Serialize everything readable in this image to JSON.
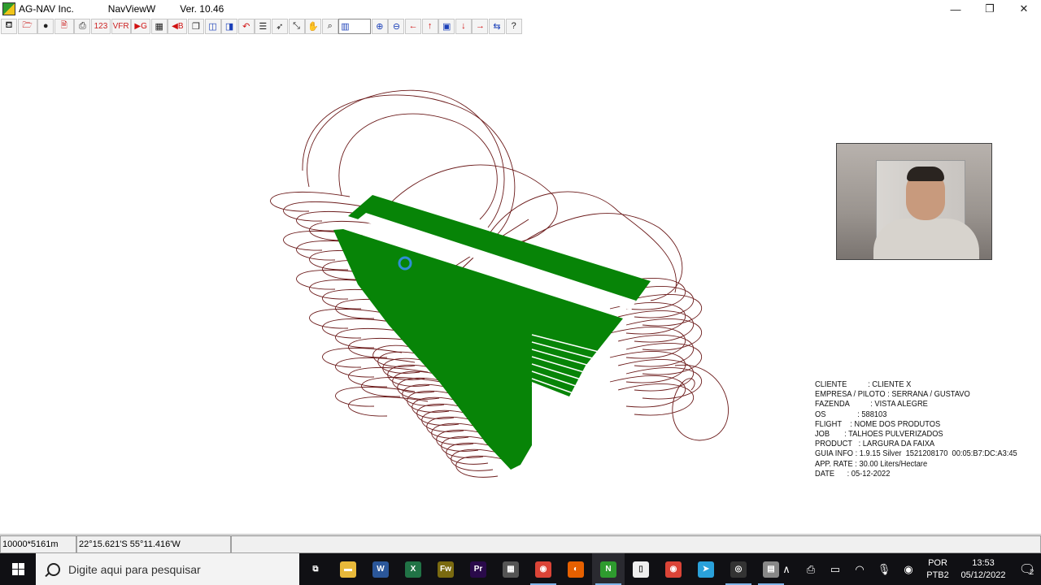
{
  "window": {
    "company": "AG-NAV Inc.",
    "app_name": "NavViewW",
    "version": "Ver. 10.46",
    "minimize": "—",
    "restore": "❐",
    "close": "✕"
  },
  "toolbar": {
    "items": [
      {
        "name": "exit-icon",
        "glyph": "⛾"
      },
      {
        "name": "open-folder-icon",
        "glyph": "🗁"
      },
      {
        "name": "globe-icon",
        "glyph": "●"
      },
      {
        "name": "document-icon",
        "glyph": "🗎"
      },
      {
        "name": "print-icon",
        "glyph": "⎙"
      },
      {
        "name": "numbers-button",
        "glyph": "123"
      },
      {
        "name": "vfr-button",
        "glyph": "VFR"
      },
      {
        "name": "arrow-right-g-icon",
        "glyph": "▶G"
      },
      {
        "name": "grid-icon",
        "glyph": "▦"
      },
      {
        "name": "arrow-left-b-icon",
        "glyph": "◀B"
      },
      {
        "name": "pages-icon",
        "glyph": "❐"
      },
      {
        "name": "frame-left-icon",
        "glyph": "◫"
      },
      {
        "name": "frame-right-icon",
        "glyph": "◨"
      },
      {
        "name": "undo-icon",
        "glyph": "↶"
      },
      {
        "name": "list-icon",
        "glyph": "☰"
      },
      {
        "name": "pointer-icon",
        "glyph": "➶"
      },
      {
        "name": "resize-icon",
        "glyph": "⤡"
      },
      {
        "name": "hand-icon",
        "glyph": "✋"
      },
      {
        "name": "zoom-window-icon",
        "glyph": "⌕"
      }
    ],
    "field_value": "▥",
    "nav_items": [
      {
        "name": "zoom-in-icon",
        "glyph": "⊕"
      },
      {
        "name": "zoom-out-icon",
        "glyph": "⊖"
      },
      {
        "name": "pan-left-icon",
        "glyph": "←"
      },
      {
        "name": "pan-up-icon",
        "glyph": "↑"
      },
      {
        "name": "fit-view-icon",
        "glyph": "▣"
      },
      {
        "name": "pan-down-icon",
        "glyph": "↓"
      },
      {
        "name": "pan-right-icon",
        "glyph": "→"
      },
      {
        "name": "swap-icon",
        "glyph": "⇆"
      },
      {
        "name": "help-icon",
        "glyph": "?"
      }
    ]
  },
  "colors": {
    "coverage": "#078407",
    "flight_path": "#6b1a1a",
    "cursor": "#2f8fd6",
    "taskbar": "#101014"
  },
  "info": {
    "rows": [
      {
        "key": "CLIENTE          ",
        "value": ": CLIENTE X"
      },
      {
        "key": "EMPRESA / PILOTO ",
        "value": ": SERRANA / GUSTAVO"
      },
      {
        "key": "FAZENDA          ",
        "value": ": VISTA ALEGRE"
      },
      {
        "key": "OS               ",
        "value": ": 588103"
      },
      {
        "key": "FLIGHT    ",
        "value": ": NOME DOS PRODUTOS"
      },
      {
        "key": "JOB       ",
        "value": ": TALHOES PULVERIZADOS"
      },
      {
        "key": "PRODUCT   ",
        "value": ": LARGURA DA FAIXA"
      },
      {
        "key": "GUIA INFO ",
        "value": ": 1.9.15 Silver  1521208170  00:05:B7:DC:A3:45"
      },
      {
        "key": "APP. RATE ",
        "value": ": 30.00 Liters/Hectare"
      },
      {
        "key": "DATE      ",
        "value": ": 05-12-2022"
      }
    ]
  },
  "statusbar": {
    "scale": "10000*5161m",
    "coordinates": "22°15.621'S 55°11.416'W",
    "message": "",
    "extra": ""
  },
  "taskbar": {
    "search_placeholder": "Digite aqui para pesquisar",
    "apps": [
      {
        "name": "task-view-icon",
        "label": "⧉",
        "color": "transparent"
      },
      {
        "name": "file-explorer-icon",
        "label": "▬",
        "color": "#e8b93a"
      },
      {
        "name": "word-icon",
        "label": "W",
        "color": "#2b579a"
      },
      {
        "name": "excel-icon",
        "label": "X",
        "color": "#217346"
      },
      {
        "name": "fireworks-icon",
        "label": "Fw",
        "color": "#7a6a10"
      },
      {
        "name": "premiere-icon",
        "label": "Pr",
        "color": "#2a0a4a"
      },
      {
        "name": "calculator-icon",
        "label": "▦",
        "color": "#555"
      },
      {
        "name": "chrome-icon",
        "label": "◉",
        "color": "#db4437"
      },
      {
        "name": "firefox-icon",
        "label": "◐",
        "color": "#e66000"
      },
      {
        "name": "navviewer-icon",
        "label": "N",
        "color": "#2e9b2e"
      },
      {
        "name": "notepad-icon",
        "label": "▯",
        "color": "#eeeeee"
      },
      {
        "name": "chrome-2-icon",
        "label": "◉",
        "color": "#db4437"
      },
      {
        "name": "telegram-icon",
        "label": "➤",
        "color": "#2aa1da"
      },
      {
        "name": "obs-icon",
        "label": "◎",
        "color": "#333"
      },
      {
        "name": "agnav-icon",
        "label": "▤",
        "color": "#888"
      }
    ],
    "lang_top": "POR",
    "lang_bottom": "PTB2",
    "time": "13:53",
    "date": "05/12/2022",
    "chevron": "∧",
    "notification_count": "2"
  }
}
